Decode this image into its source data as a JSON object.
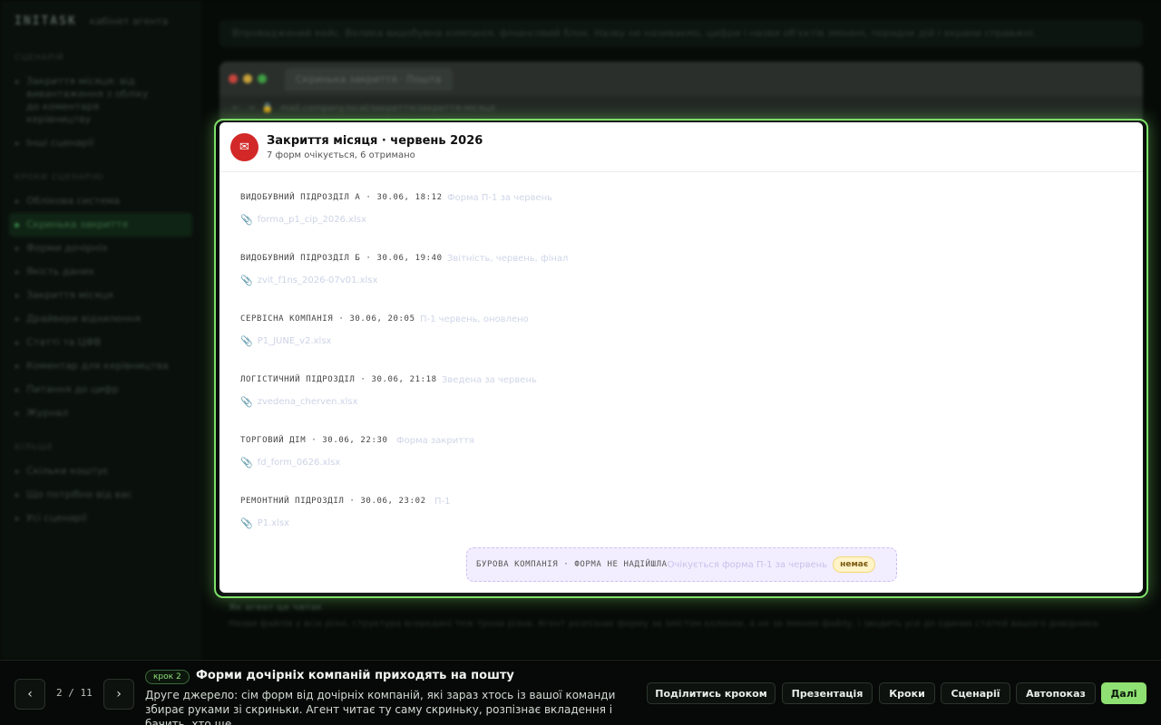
{
  "sidebar": {
    "brand": "INITASK",
    "brand_sub": "кабінет агента",
    "section_scenario": "Сценарій",
    "scenario_items": [
      "Закриття місяця: від вивантаження з обліку до коментаря керівництву",
      "Інші сценарії"
    ],
    "section_steps": "Кроки сценарію",
    "step_items": [
      "Облікова система",
      "Скринька закриття",
      "Форми дочірніх",
      "Якість даних",
      "Закриття місяця",
      "Драйвери відхилення",
      "Статті та ЦФВ",
      "Коментар для керівництва",
      "Питання до цифр",
      "Журнал"
    ],
    "section_more": "Більше",
    "more_items": [
      "Скільки коштує",
      "Що потрібно від вас",
      "Усі сценарії"
    ]
  },
  "background": {
    "note": "Впроваджений кейс. Велика видобувна компанія, фінансовий блок. Назву не називаємо, цифри і назви об'єктів змінені, порядок дій і екрани справжні.",
    "browser_tab": "Скринька закриття · Пошта",
    "browser_url": "mail.company.local/закриття/закриття-місяця",
    "bottom_title": "Як агент це читає",
    "bottom_text": "Назви файлів у всіх різні, структура всередині теж трохи різна. Агент розпізнає форму за змістом колонок, а не за іменем файлу, і зводить усе до єдиних статей вашого довідника."
  },
  "card": {
    "title": "Закриття місяця · червень 2026",
    "subtitle": "7 форм очікується, 6 отримано",
    "messages": [
      {
        "meta": "ВИДОБУВНИЙ ПІДРОЗДІЛ А · 30.06, 18:12",
        "subject": "Форма П-1 за червень",
        "attachment": "forma_p1_cip_2026.xlsx"
      },
      {
        "meta": "ВИДОБУВНИЙ ПІДРОЗДІЛ Б · 30.06, 19:40",
        "subject": "Звітність, червень, фінал",
        "attachment": "zvit_f1ns_2026-07v01.xlsx"
      },
      {
        "meta": "СЕРВІСНА КОМПАНІЯ · 30.06, 20:05",
        "subject": "П-1 червень, оновлено",
        "attachment": "P1_JUNE_v2.xlsx"
      },
      {
        "meta": "ЛОГІСТИЧНИЙ ПІДРОЗДІЛ · 30.06, 21:18",
        "subject": "Зведена за червень",
        "attachment": "zvedena_cherven.xlsx"
      },
      {
        "meta": "ТОРГОВИЙ ДІМ · 30.06, 22:30",
        "subject": "Форма закриття",
        "attachment": "fd_form_0626.xlsx"
      },
      {
        "meta": "РЕМОНТНИЙ ПІДРОЗДІЛ · 30.06, 23:02",
        "subject": "П-1",
        "attachment": "P1.xlsx"
      }
    ],
    "missing": {
      "meta": "БУРОВА КОМПАНІЯ · ФОРМА НЕ НАДІЙШЛА",
      "subject": "Очікується форма П-1 за червень",
      "badge": "немає"
    }
  },
  "tour": {
    "prev_label": "‹",
    "next_arrow": "›",
    "counter": "2 / 11",
    "step_badge": "крок 2",
    "step_title": "Форми дочірніх компаній приходять на пошту",
    "step_desc": "Друге джерело: сім форм від дочірніх компаній, які зараз хтось із вашої команди збирає руками зі скриньки. Агент читає ту саму скриньку, розпізнає вкладення і бачить, хто ще...",
    "buttons": {
      "share": "Поділитись кроком",
      "presentation": "Презентація",
      "steps": "Кроки",
      "scenarios": "Сценарії",
      "autoplay": "Автопоказ",
      "next": "Далі"
    }
  },
  "colors": {
    "accent_green": "#8fe072",
    "mail_red": "#d32828",
    "missing_bg": "#f3eeff",
    "badge_yellow": "#fff3c8"
  }
}
